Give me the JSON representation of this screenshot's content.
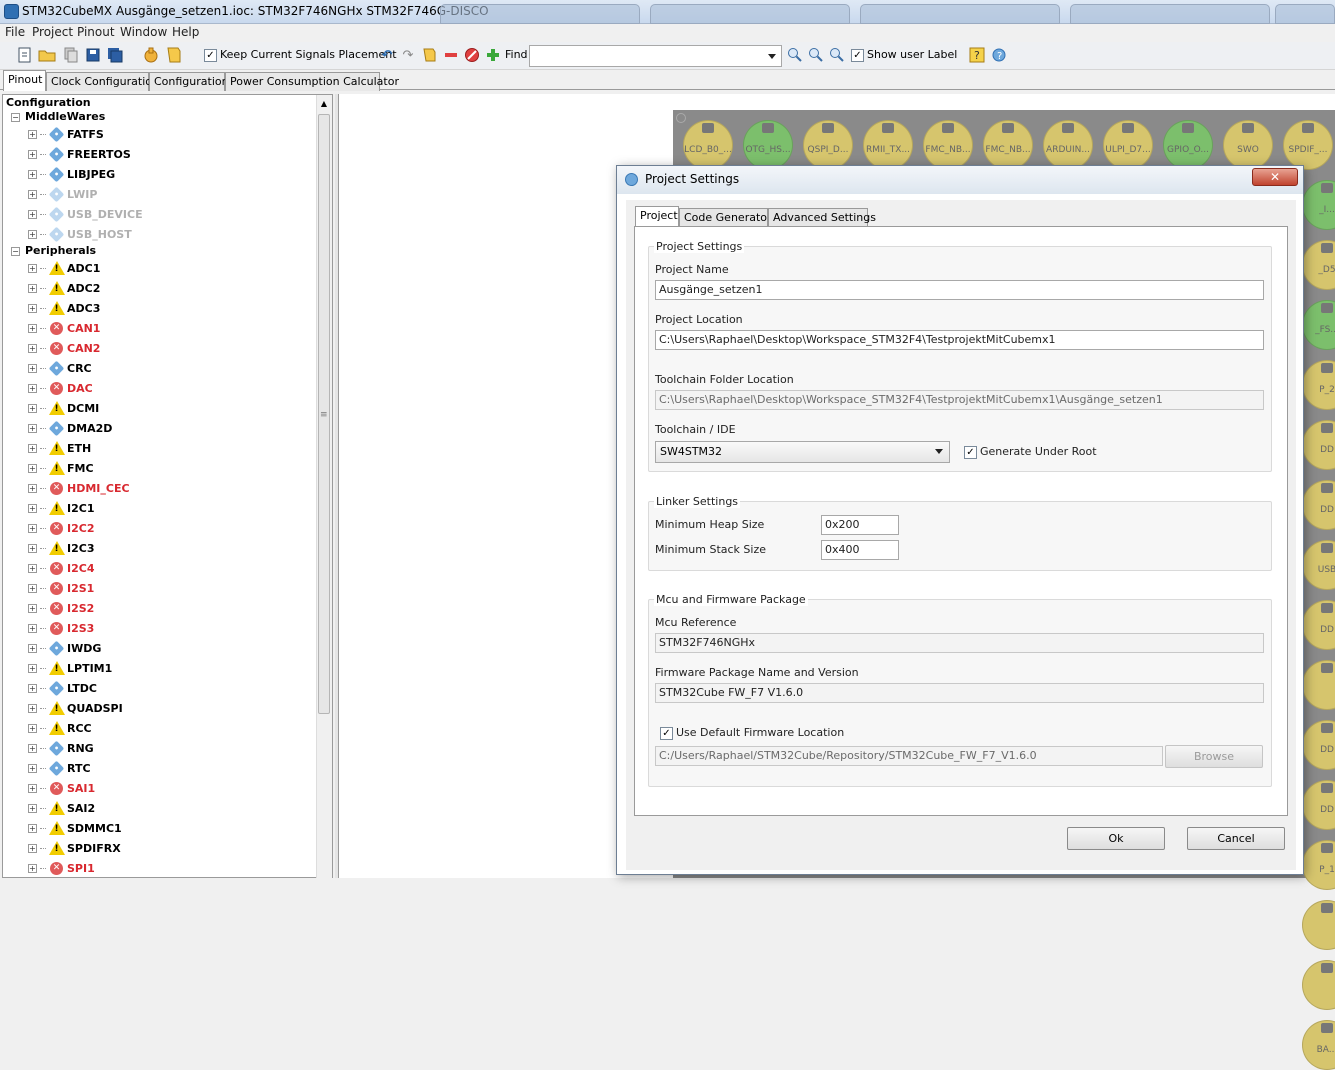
{
  "window": {
    "title": "STM32CubeMX Ausgänge_setzen1.ioc: STM32F746NGHx STM32F746G-DISCO"
  },
  "menu": [
    "File",
    "Project",
    "Pinout",
    "Window",
    "Help"
  ],
  "toolbar": {
    "keep_signals_label": "Keep Current Signals Placement",
    "keep_signals_checked": true,
    "find_label": "Find",
    "find_value": "",
    "show_user_label": "Show user Label",
    "show_user_checked": true
  },
  "tabs": [
    "Pinout",
    "Clock Configuration",
    "Configuration",
    "Power Consumption Calculator"
  ],
  "tree": {
    "root": "Configuration",
    "middlewares_label": "MiddleWares",
    "middlewares": [
      {
        "label": "FATFS",
        "status": "ok"
      },
      {
        "label": "FREERTOS",
        "status": "ok"
      },
      {
        "label": "LIBJPEG",
        "status": "ok"
      },
      {
        "label": "LWIP",
        "status": "disabled"
      },
      {
        "label": "USB_DEVICE",
        "status": "disabled"
      },
      {
        "label": "USB_HOST",
        "status": "disabled"
      }
    ],
    "peripherals_label": "Peripherals",
    "peripherals": [
      {
        "label": "ADC1",
        "status": "warn"
      },
      {
        "label": "ADC2",
        "status": "warn"
      },
      {
        "label": "ADC3",
        "status": "warn"
      },
      {
        "label": "CAN1",
        "status": "error"
      },
      {
        "label": "CAN2",
        "status": "error"
      },
      {
        "label": "CRC",
        "status": "ok"
      },
      {
        "label": "DAC",
        "status": "error"
      },
      {
        "label": "DCMI",
        "status": "warn"
      },
      {
        "label": "DMA2D",
        "status": "ok"
      },
      {
        "label": "ETH",
        "status": "warn"
      },
      {
        "label": "FMC",
        "status": "warn"
      },
      {
        "label": "HDMI_CEC",
        "status": "error"
      },
      {
        "label": "I2C1",
        "status": "warn"
      },
      {
        "label": "I2C2",
        "status": "error"
      },
      {
        "label": "I2C3",
        "status": "warn"
      },
      {
        "label": "I2C4",
        "status": "error"
      },
      {
        "label": "I2S1",
        "status": "error"
      },
      {
        "label": "I2S2",
        "status": "error"
      },
      {
        "label": "I2S3",
        "status": "error"
      },
      {
        "label": "IWDG",
        "status": "ok"
      },
      {
        "label": "LPTIM1",
        "status": "warn"
      },
      {
        "label": "LTDC",
        "status": "ok"
      },
      {
        "label": "QUADSPI",
        "status": "warn"
      },
      {
        "label": "RCC",
        "status": "warn"
      },
      {
        "label": "RNG",
        "status": "ok"
      },
      {
        "label": "RTC",
        "status": "ok"
      },
      {
        "label": "SAI1",
        "status": "error"
      },
      {
        "label": "SAI2",
        "status": "warn"
      },
      {
        "label": "SDMMC1",
        "status": "warn"
      },
      {
        "label": "SPDIFRX",
        "status": "warn"
      },
      {
        "label": "SPI1",
        "status": "error"
      }
    ]
  },
  "pins_top": [
    {
      "label": "LCD_B0_...",
      "color": "y"
    },
    {
      "label": "OTG_HS...",
      "color": "g"
    },
    {
      "label": "QSPI_D...",
      "color": "y"
    },
    {
      "label": "RMII_TX...",
      "color": "y"
    },
    {
      "label": "FMC_NB...",
      "color": "y"
    },
    {
      "label": "FMC_NB...",
      "color": "y"
    },
    {
      "label": "ARDUIN...",
      "color": "y"
    },
    {
      "label": "ULPI_D7...",
      "color": "y"
    },
    {
      "label": "GPIO_O...",
      "color": "g"
    },
    {
      "label": "SWO",
      "color": "y"
    },
    {
      "label": "SPDIF_...",
      "color": "y"
    }
  ],
  "pins_right": [
    {
      "label": "_I...",
      "color": "g"
    },
    {
      "label": "_D5",
      "color": "y"
    },
    {
      "label": "_FS...",
      "color": "g"
    },
    {
      "label": "P_2",
      "color": "y"
    },
    {
      "label": "DD",
      "color": "y"
    },
    {
      "label": "DD",
      "color": "y"
    },
    {
      "label": "USB",
      "color": "y"
    },
    {
      "label": "DD",
      "color": "y"
    },
    {
      "label": "",
      "color": "y"
    },
    {
      "label": "DD",
      "color": "y"
    },
    {
      "label": "DD",
      "color": "y"
    },
    {
      "label": "P_1",
      "color": "y"
    },
    {
      "label": "",
      "color": "y"
    },
    {
      "label": "",
      "color": "y"
    },
    {
      "label": "BA...",
      "color": "y"
    }
  ],
  "dialog": {
    "title": "Project Settings",
    "tabs": [
      "Project",
      "Code Generator",
      "Advanced Settings"
    ],
    "group_project": "Project Settings",
    "project_name_label": "Project Name",
    "project_name": "Ausgänge_setzen1",
    "project_location_label": "Project Location",
    "project_location": "C:\\Users\\Raphael\\Desktop\\Workspace_STM32F4\\TestprojektMitCubemx1",
    "toolchain_folder_label": "Toolchain Folder Location",
    "toolchain_folder": "C:\\Users\\Raphael\\Desktop\\Workspace_STM32F4\\TestprojektMitCubemx1\\Ausgänge_setzen1",
    "toolchain_ide_label": "Toolchain / IDE",
    "toolchain_ide": "SW4STM32",
    "generate_under_root_label": "Generate Under Root",
    "generate_under_root": true,
    "group_linker": "Linker Settings",
    "heap_label": "Minimum Heap Size",
    "heap": "0x200",
    "stack_label": "Minimum Stack Size",
    "stack": "0x400",
    "group_mcu": "Mcu and Firmware Package",
    "mcu_ref_label": "Mcu Reference",
    "mcu_ref": "STM32F746NGHx",
    "fw_label": "Firmware Package Name and Version",
    "fw": "STM32Cube FW_F7 V1.6.0",
    "use_default_fw_label": "Use Default Firmware Location",
    "use_default_fw": true,
    "fw_location": "C:/Users/Raphael/STM32Cube/Repository/STM32Cube_FW_F7_V1.6.0",
    "browse_label": "Browse",
    "ok_label": "Ok",
    "cancel_label": "Cancel"
  }
}
